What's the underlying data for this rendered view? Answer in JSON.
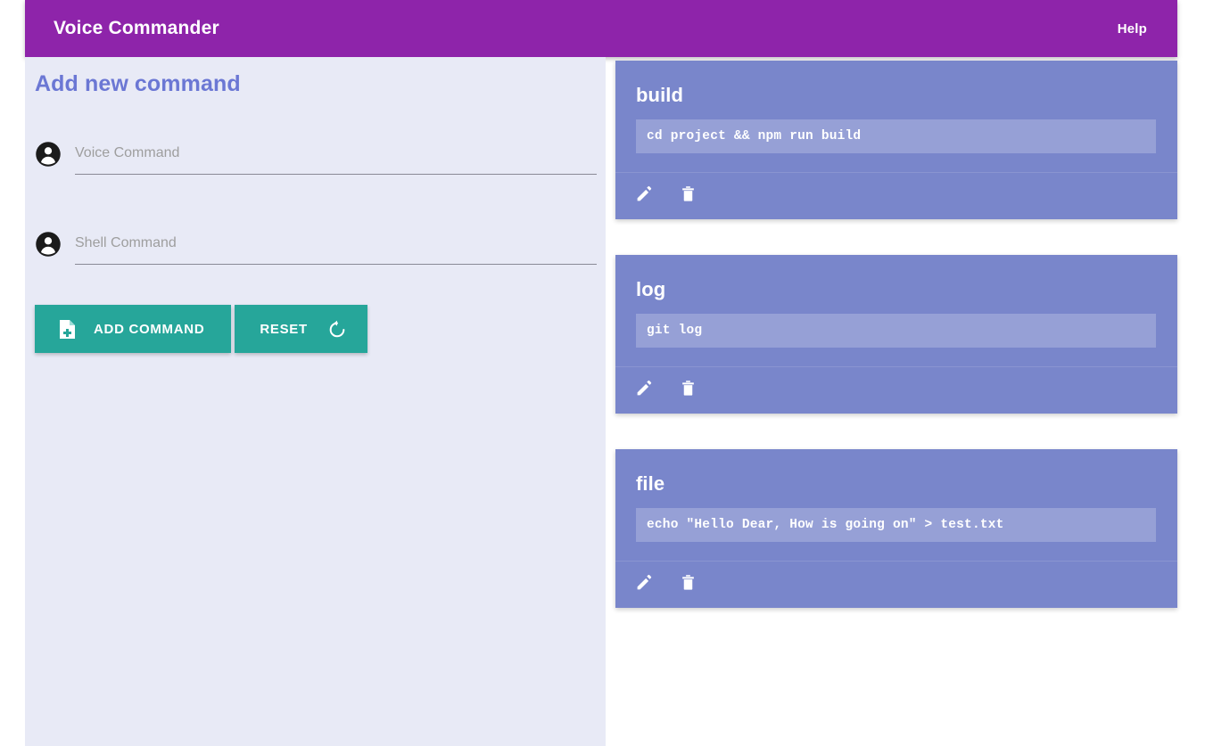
{
  "header": {
    "title": "Voice Commander",
    "help_label": "Help",
    "background_color": "#8e24aa"
  },
  "form": {
    "title": "Add new command",
    "fields": [
      {
        "icon": "account-circle-icon",
        "placeholder": "Voice Command",
        "value": ""
      },
      {
        "icon": "account-circle-icon",
        "placeholder": "Shell Command",
        "value": ""
      }
    ],
    "buttons": {
      "add_label": "ADD COMMAND",
      "add_icon": "file-plus-icon",
      "reset_label": "RESET",
      "reset_icon": "rotate-left-icon",
      "color": "#26a69a"
    },
    "panel_color": "#e8eaf6",
    "title_color": "#6b77d4"
  },
  "commands": {
    "card_color": "#7986cb",
    "edit_icon": "pencil-icon",
    "delete_icon": "trash-icon",
    "items": [
      {
        "name": "build",
        "command": "cd project && npm run build"
      },
      {
        "name": "log",
        "command": "git log"
      },
      {
        "name": "file",
        "command": "echo \"Hello Dear, How is going on\" > test.txt"
      }
    ]
  }
}
